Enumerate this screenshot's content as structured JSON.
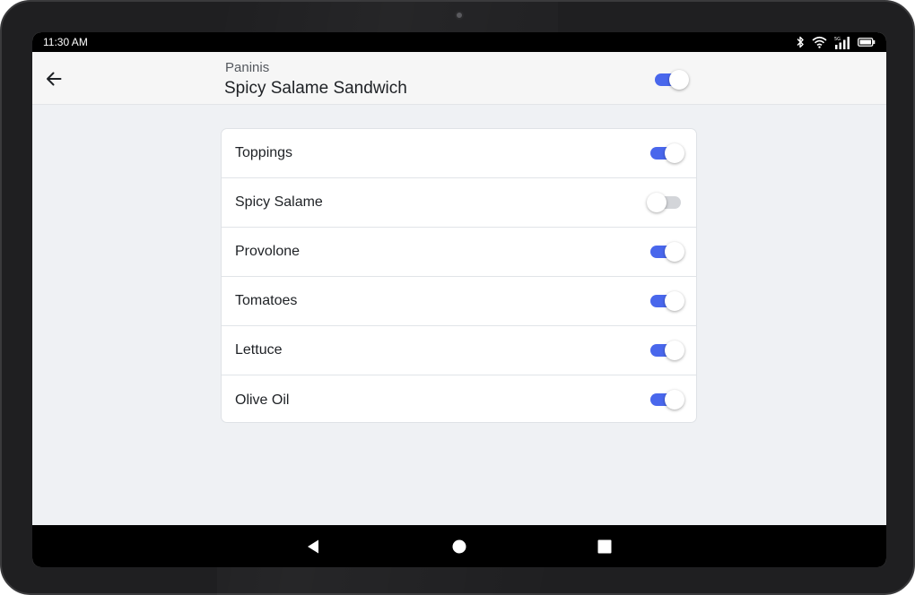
{
  "status_bar": {
    "time": "11:30 AM",
    "icons": [
      "bluetooth-icon",
      "wifi-icon",
      "signal-5g-icon",
      "battery-icon"
    ]
  },
  "header": {
    "category": "Paninis",
    "title": "Spicy Salame Sandwich",
    "enabled": true
  },
  "items": [
    {
      "label": "Toppings",
      "enabled": true
    },
    {
      "label": "Spicy Salame",
      "enabled": false
    },
    {
      "label": "Provolone",
      "enabled": true
    },
    {
      "label": "Tomatoes",
      "enabled": true
    },
    {
      "label": "Lettuce",
      "enabled": true
    },
    {
      "label": "Olive Oil",
      "enabled": true
    }
  ],
  "nav_bar": {
    "buttons": [
      "back-triangle-icon",
      "home-circle-icon",
      "recents-square-icon"
    ]
  },
  "colors": {
    "accent": "#4967ec",
    "toggle_off_track": "#d3d5d9",
    "screen_background": "#eff1f4"
  }
}
